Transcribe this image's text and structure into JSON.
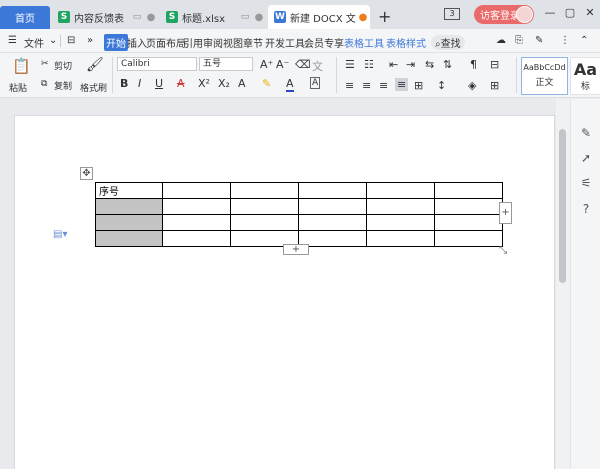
{
  "tabs": {
    "home": "首页",
    "docs": [
      {
        "label": "内容反馈表",
        "type": "S"
      },
      {
        "label": "标题.xlsx",
        "type": "S"
      },
      {
        "label": "新建 DOCX 文",
        "type": "W"
      }
    ],
    "new_tab": "+"
  },
  "titlebar": {
    "page_count": "3",
    "visitor_login": "访客登录",
    "minimize": "—",
    "restore": "▢",
    "close": "✕"
  },
  "menu": {
    "file": "文件",
    "items": [
      "开始",
      "插入",
      "页面布局",
      "引用",
      "审阅",
      "视图",
      "章节",
      "开发工具",
      "会员专享"
    ],
    "context": [
      "表格工具",
      "表格样式"
    ],
    "search": "查找"
  },
  "ribbon": {
    "paste": "粘贴",
    "cut": "剪切",
    "copy": "复制",
    "format_painter": "格式刷",
    "font_name": "Calibri",
    "font_size": "五号",
    "style_normal_preview": "AaBbCcDd",
    "style_normal": "正文",
    "style_heading_preview": "Aa",
    "style_heading": "标"
  },
  "table": {
    "header_cell": "序号",
    "rows": 4,
    "cols": 6
  },
  "colors": {
    "accent": "#3c78d8",
    "visitor": "#e96a6a",
    "sheet_icon": "#1fa463"
  }
}
